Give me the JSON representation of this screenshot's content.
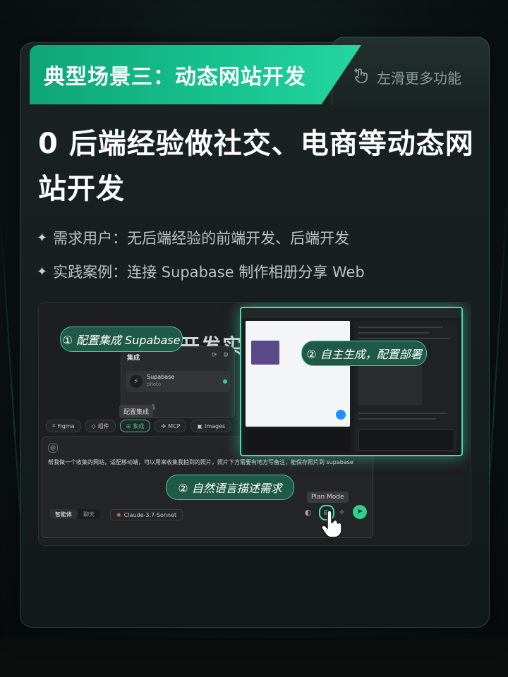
{
  "header": {
    "tab_title": "典型场景三：动态网站开发",
    "swipe_hint": "左滑更多功能",
    "swipe_icon": "swipe-hand-icon"
  },
  "headline": "0 后端经验做社交、电商等动态网站开发",
  "bullets": [
    {
      "label": "需求用户：无后端经验的前端开发、后端开发"
    },
    {
      "label": "实践案例：连接 Supabase 制作相册分享 Web"
    }
  ],
  "screenshot": {
    "background_title": "开发实时",
    "step1": "① 配置集成 Supabase",
    "step2": "② 自主生成，配置部署",
    "step3": "② 自然语言描述需求",
    "integration_panel": {
      "title": "集成",
      "service_name": "Supabase",
      "service_sub": "photo",
      "tooltip": "配置集成",
      "config_tail": "成"
    },
    "toolbar": [
      "Figma",
      "组件",
      "集成",
      "MCP",
      "Images"
    ],
    "prompt_text": "帮我做一个收集的网站，适配移动端，可以用来收集我拍到的照片，照片下方需要有地方写备注，能保存照片到 supabase",
    "mode_tabs": [
      "智能体",
      "聊天"
    ],
    "model": "Claude-3.7-Sonnet",
    "plan_mode_tooltip": "Plan Mode",
    "accent": "#3fe0a8"
  }
}
